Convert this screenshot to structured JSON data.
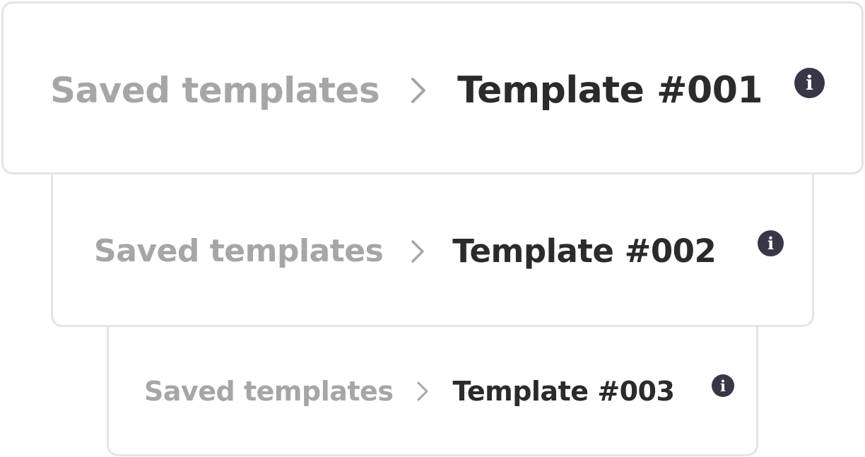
{
  "breadcrumbs": [
    {
      "parent_label": "Saved templates",
      "separator_icon": "chevron-right-icon",
      "current_label": "Template #001",
      "info_icon": "info-icon"
    },
    {
      "parent_label": "Saved templates",
      "separator_icon": "chevron-right-icon",
      "current_label": "Template #002",
      "info_icon": "info-icon"
    },
    {
      "parent_label": "Saved templates",
      "separator_icon": "chevron-right-icon",
      "current_label": "Template #003",
      "info_icon": "info-icon"
    }
  ],
  "colors": {
    "parent_text": "#a6a6a6",
    "current_text": "#2b2b2d",
    "info_badge": "#373748",
    "card_border": "#e4e4e7"
  }
}
